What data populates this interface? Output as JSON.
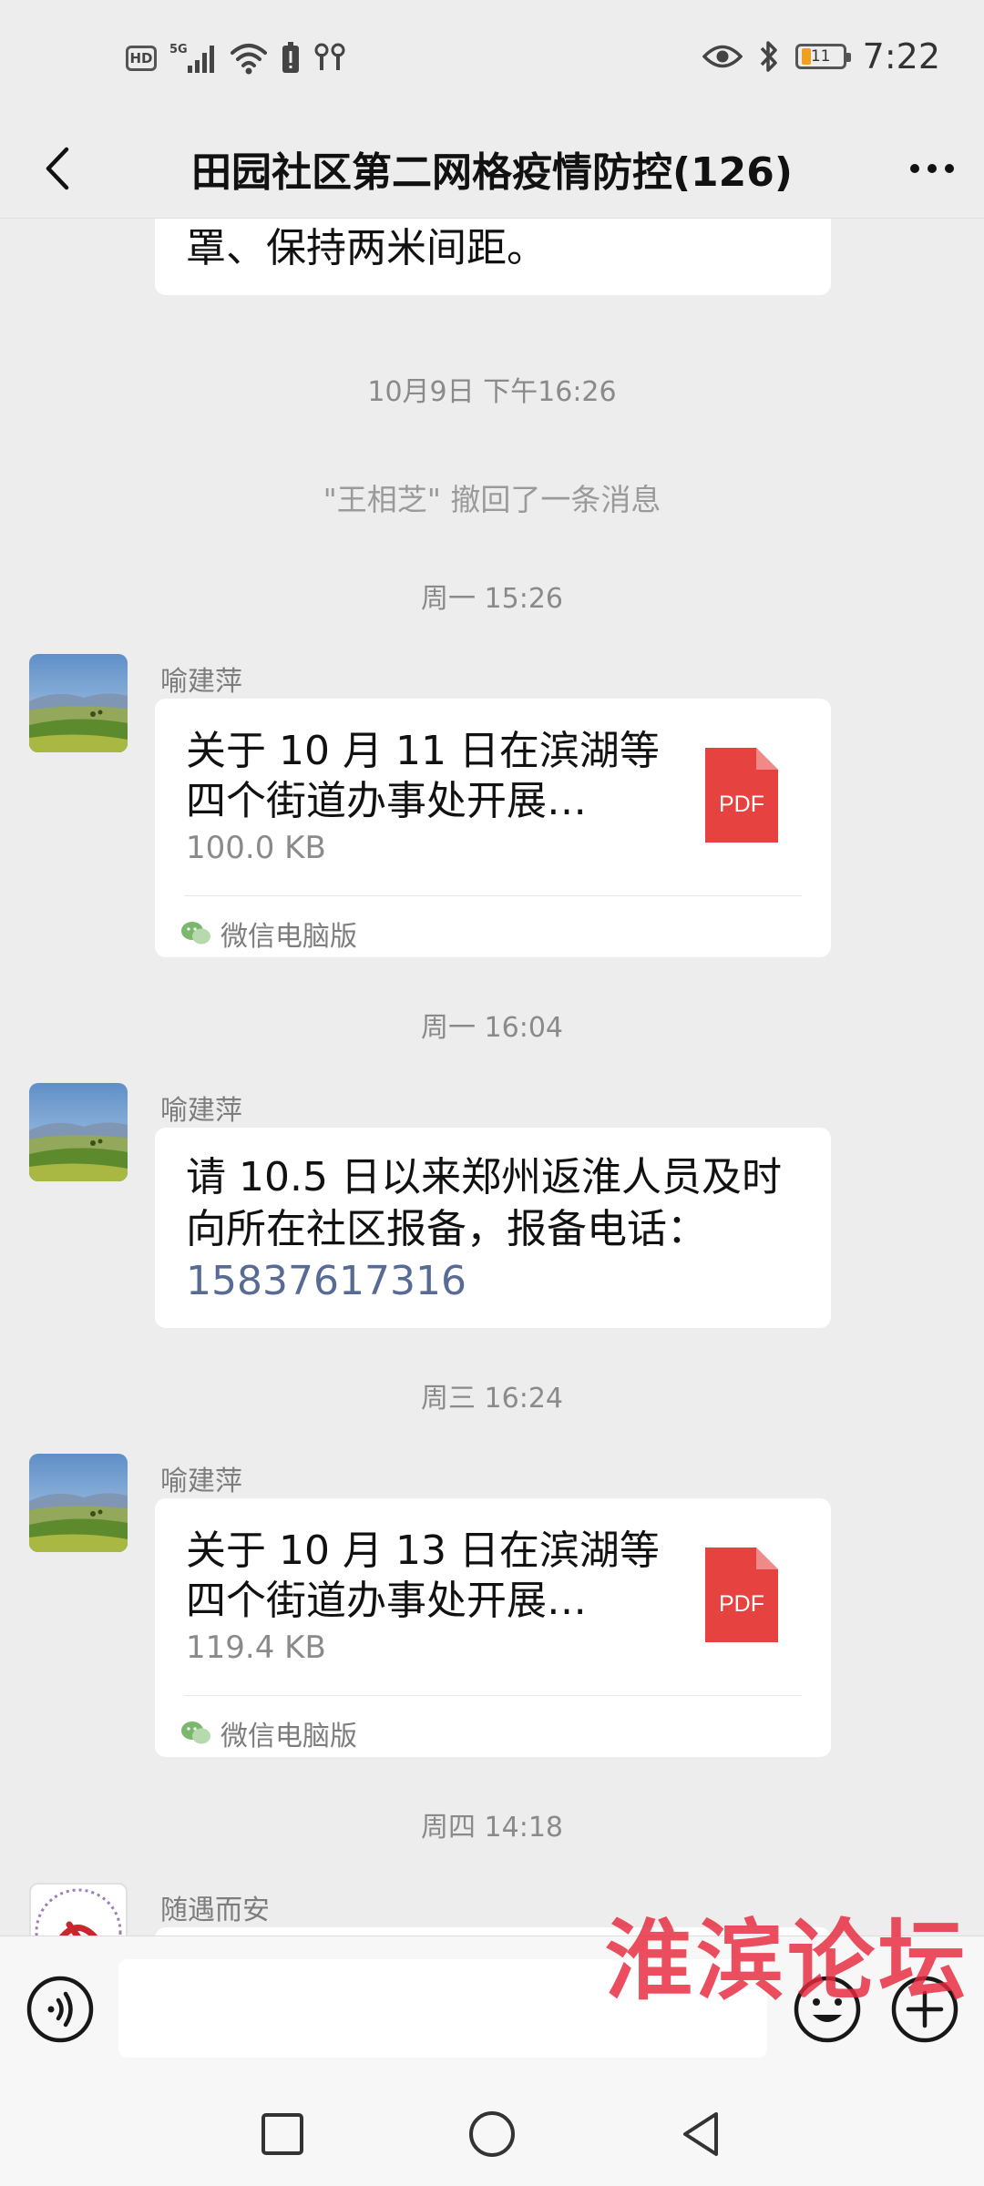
{
  "status_bar": {
    "hd": "HD",
    "network": "5G",
    "battery_level": "11",
    "time": "7:22",
    "icons": [
      "hd-icon",
      "signal-5g-icon",
      "wifi-icon",
      "alert-icon",
      "earbuds-icon",
      "eye-icon",
      "bluetooth-icon",
      "battery-icon"
    ]
  },
  "nav": {
    "title": "田园社区第二网格疫情防控(126)",
    "back_icon": "chevron-left-icon",
    "more_icon": "more-dots-icon"
  },
  "chat": {
    "partial_message_tail": "罩、保持两米间距。",
    "timestamps": [
      "10月9日 下午16:26",
      "周一 15:26",
      "周一 16:04",
      "周三 16:24",
      "周四 14:18"
    ],
    "system_message": "\"王相芝\" 撤回了一条消息",
    "messages": [
      {
        "sender": "喻建萍",
        "type": "file",
        "title": "关于 10 月 11 日在滨湖等四个街道办事处开展…",
        "size": "100.0 KB",
        "file_type": "PDF",
        "source": "微信电脑版"
      },
      {
        "sender": "喻建萍",
        "type": "text",
        "text": "请 10.5 日以来郑州返淮人员及时向所在社区报备，报备电话：",
        "phone": "15837617316"
      },
      {
        "sender": "喻建萍",
        "type": "file",
        "title": "关于 10 月 13 日在滨湖等四个街道办事处开展…",
        "size": "119.4 KB",
        "file_type": "PDF",
        "source": "微信电脑版"
      },
      {
        "sender": "随遇而安",
        "type": "text",
        "text": ""
      }
    ]
  },
  "input_bar": {
    "voice_icon": "voice-icon",
    "emoji_icon": "emoji-icon",
    "plus_icon": "plus-icon"
  },
  "watermark": "淮滨论坛",
  "colors": {
    "background": "#ededed",
    "bubble": "#ffffff",
    "link": "#576b95",
    "pdf": "#e64340",
    "watermark": "#e6283c"
  }
}
